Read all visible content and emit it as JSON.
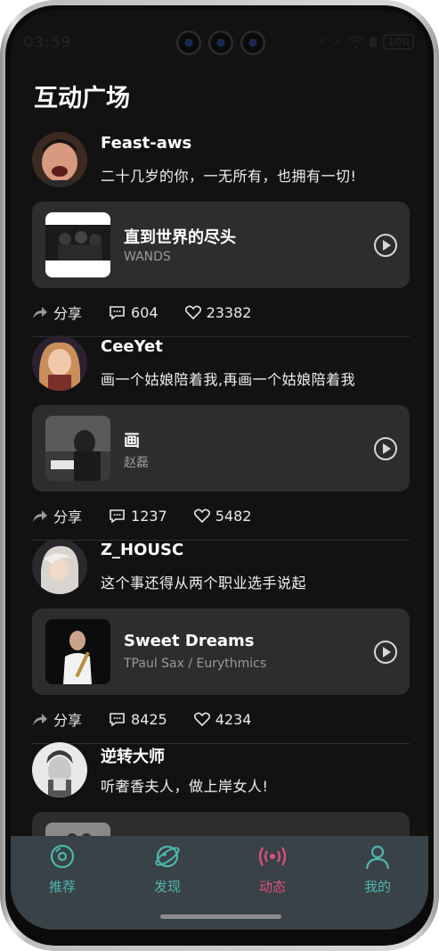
{
  "status_bar": {
    "time": "03:59",
    "battery": "100"
  },
  "page": {
    "title": "互动广场"
  },
  "posts": [
    {
      "username": "Feast-aws",
      "text": "二十几岁的你，一无所有，也拥有一切!",
      "song": {
        "title": "直到世界的尽头",
        "artist": "WANDS"
      },
      "share_label": "分享",
      "comments": "604",
      "likes": "23382"
    },
    {
      "username": "CeeYet",
      "text": "画一个姑娘陪着我,再画一个姑娘陪着我",
      "song": {
        "title": "画",
        "artist": "赵磊"
      },
      "share_label": "分享",
      "comments": "1237",
      "likes": "5482"
    },
    {
      "username": "Z_HOUSC",
      "text": "这个事还得从两个职业选手说起",
      "song": {
        "title": "Sweet Dreams",
        "artist": "TPaul Sax / Eurythmics"
      },
      "share_label": "分享",
      "comments": "8425",
      "likes": "4234"
    },
    {
      "username": "逆转大师",
      "text": "听奢香夫人，做上岸女人!"
    }
  ],
  "tabs": [
    {
      "label": "推荐",
      "icon": "disc-icon"
    },
    {
      "label": "发现",
      "icon": "planet-icon"
    },
    {
      "label": "动态",
      "icon": "broadcast-icon",
      "active": true
    },
    {
      "label": "我的",
      "icon": "user-icon"
    }
  ],
  "colors": {
    "accent": "#e0517f",
    "tab_inactive": "#4db6ad",
    "tab_bar": "#394246",
    "card": "#2d2d2d"
  }
}
